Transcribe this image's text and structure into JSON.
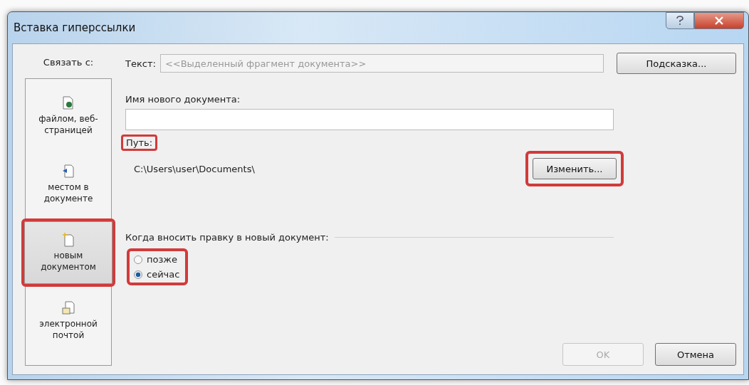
{
  "window": {
    "title": "Вставка гиперссылки"
  },
  "link_to": {
    "label": "Связать с:",
    "items": [
      {
        "label": "файлом, веб-страницей",
        "kind": "file",
        "selected": false,
        "highlighted": false
      },
      {
        "label": "местом в документе",
        "kind": "place",
        "selected": false,
        "highlighted": false
      },
      {
        "label": "новым документом",
        "kind": "new",
        "selected": true,
        "highlighted": true
      },
      {
        "label": "электронной почтой",
        "kind": "mail",
        "selected": false,
        "highlighted": false
      }
    ]
  },
  "text_field": {
    "label": "Текст:",
    "placeholder": "<<Выделенный фрагмент документа>>"
  },
  "tooltip_button": {
    "label": "Подсказка..."
  },
  "new_document": {
    "label": "Имя нового документа:"
  },
  "path": {
    "label": "Путь:",
    "highlighted": true,
    "value": "C:\\Users\\user\\Documents\\"
  },
  "change_button": {
    "label": "Изменить...",
    "highlighted": true
  },
  "when_edit": {
    "label": "Когда вносить правку в новый документ:",
    "highlighted": true,
    "options": [
      {
        "label": "позже",
        "selected": false
      },
      {
        "label": "сейчас",
        "selected": true
      }
    ]
  },
  "buttons": [
    {
      "label": "OK",
      "disabled": true
    },
    {
      "label": "Отмена",
      "disabled": false
    }
  ]
}
